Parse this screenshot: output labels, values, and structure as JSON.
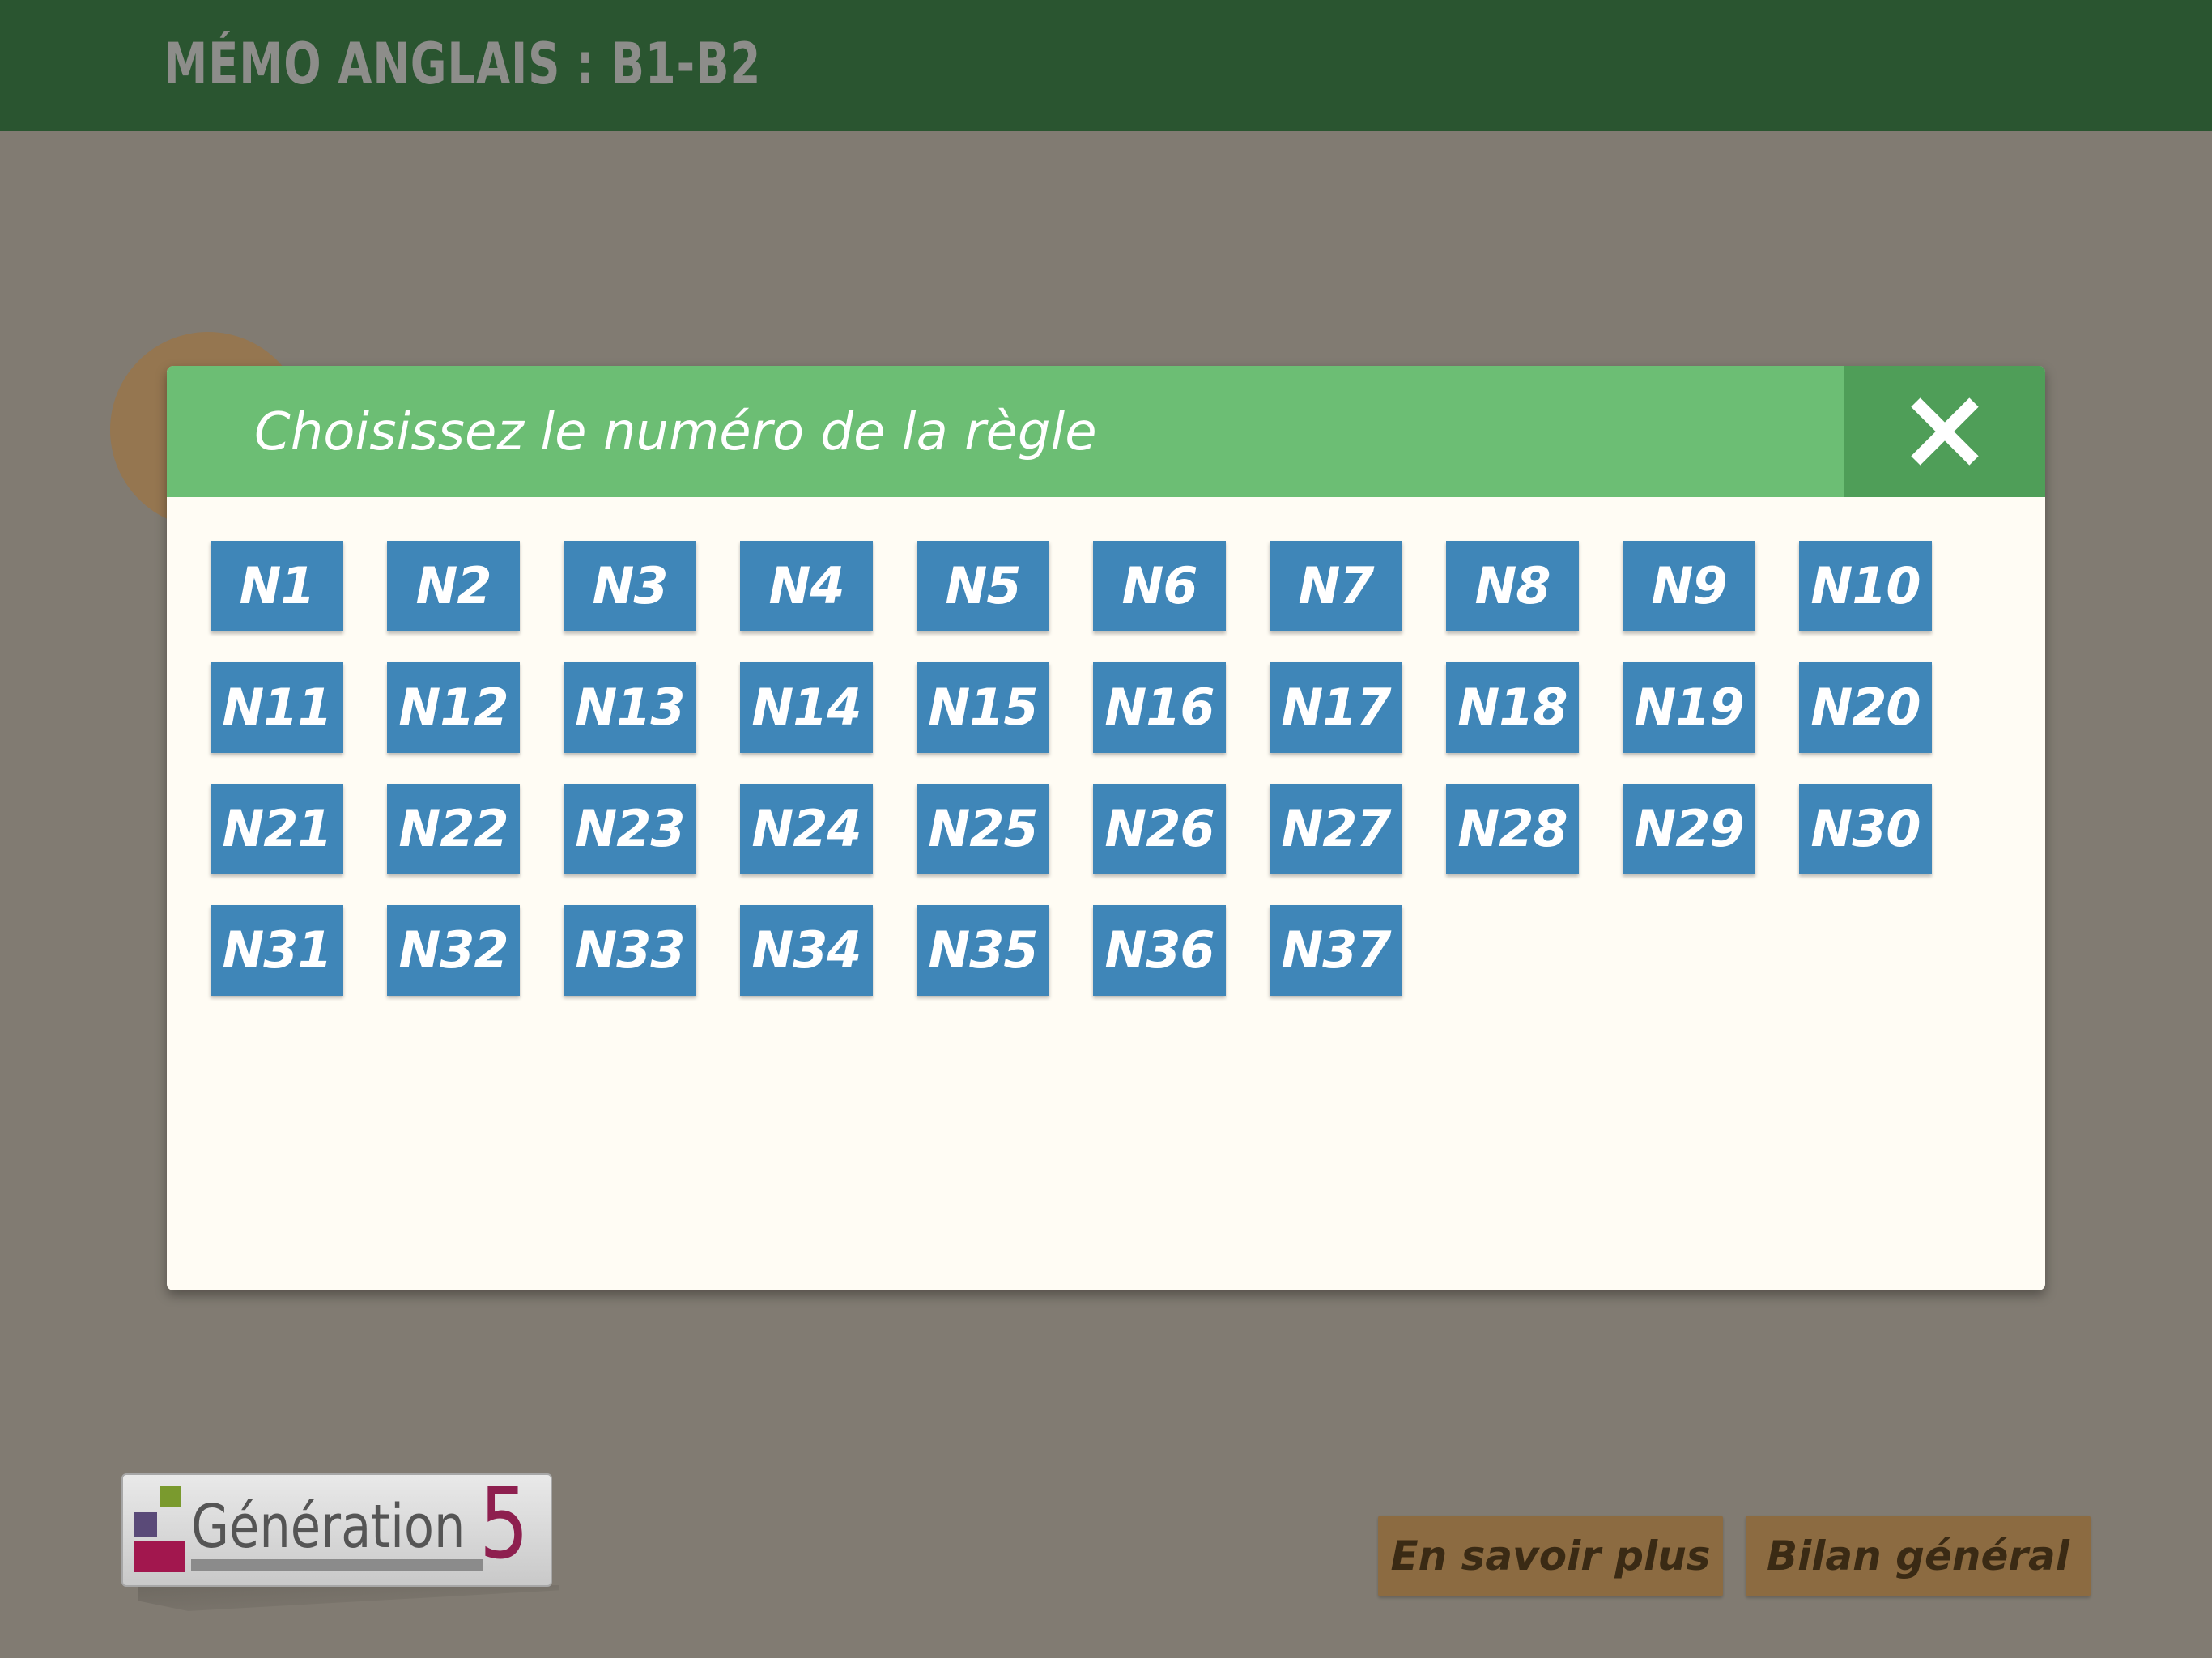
{
  "header": {
    "title": "MÉMO ANGLAIS : B1-B2"
  },
  "modal": {
    "title": "Choisissez le numéro de la règle",
    "close_icon": "close-icon",
    "rules": [
      "N1",
      "N2",
      "N3",
      "N4",
      "N5",
      "N6",
      "N7",
      "N8",
      "N9",
      "N10",
      "N11",
      "N12",
      "N13",
      "N14",
      "N15",
      "N16",
      "N17",
      "N18",
      "N19",
      "N20",
      "N21",
      "N22",
      "N23",
      "N24",
      "N25",
      "N26",
      "N27",
      "N28",
      "N29",
      "N30",
      "N31",
      "N32",
      "N33",
      "N34",
      "N35",
      "N36",
      "N37"
    ]
  },
  "logo": {
    "text": "Génération",
    "number": "5"
  },
  "footer": {
    "learn_more_label": "En savoir plus",
    "summary_label": "Bilan général"
  },
  "colors": {
    "header": "#2a5530",
    "modal_header": "#6cbe74",
    "close_bg": "#4f9e58",
    "rule_button": "#3f86b8",
    "footer_button": "#8c6b41"
  }
}
